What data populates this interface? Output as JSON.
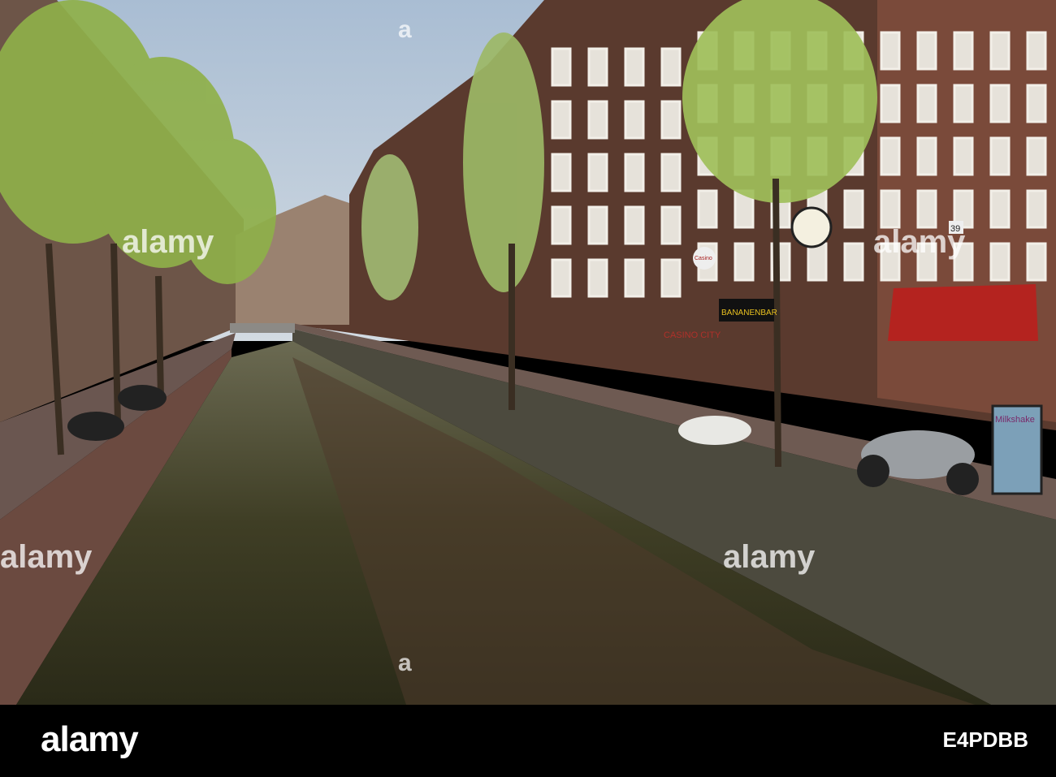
{
  "watermark": {
    "brand": "alamy",
    "mark": "a",
    "image_id": "E4PDBB"
  },
  "signs": {
    "casino_city": "CASINO CITY",
    "bananenbar": "BANANENBAR",
    "casino": "Casino",
    "milkshake": "Milkshake",
    "house_number": "39"
  },
  "colors": {
    "sky": "#b7c7d8",
    "water": "#3d3b22",
    "brick": "#5b3b2f",
    "awning": "#b4231f",
    "foliage": "#8fb04a"
  }
}
